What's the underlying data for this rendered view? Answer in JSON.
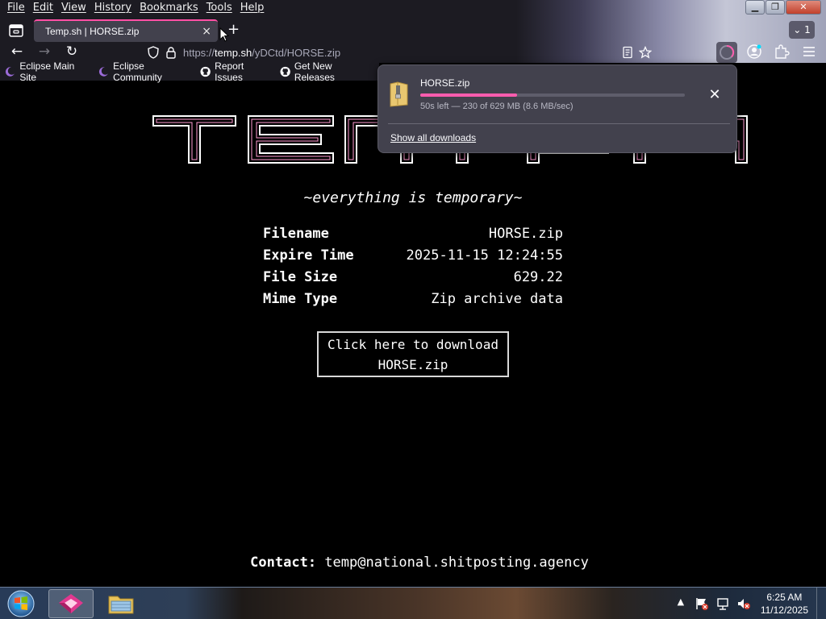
{
  "menubar": {
    "items": [
      "File",
      "Edit",
      "View",
      "History",
      "Bookmarks",
      "Tools",
      "Help"
    ]
  },
  "tab": {
    "title": "Temp.sh | HORSE.zip",
    "close": "×",
    "tab_count": "1"
  },
  "urlbar": {
    "prefix": "https://",
    "host": "temp.sh",
    "path": "/yDCtd/HORSE.zip"
  },
  "bookmarks": [
    {
      "label": "Eclipse Main Site",
      "icon": "eclipse-icon"
    },
    {
      "label": "Eclipse Community",
      "icon": "eclipse-icon"
    },
    {
      "label": "Report Issues",
      "icon": "github-icon"
    },
    {
      "label": "Get New Releases",
      "icon": "github-icon"
    }
  ],
  "page": {
    "logo": "TEMP.SH",
    "tagline": "~everything is temporary~",
    "info": [
      {
        "label": "Filename",
        "value": "HORSE.zip"
      },
      {
        "label": "Expire Time",
        "value": "2025-11-15 12:24:55"
      },
      {
        "label": "File Size",
        "value": "629.22"
      },
      {
        "label": "Mime Type",
        "value": "Zip archive data"
      }
    ],
    "download_button": {
      "line1": "Click here to download",
      "line2": "HORSE.zip"
    },
    "contact": {
      "label": "Contact:",
      "value": "temp@national.shitposting.agency"
    }
  },
  "download_panel": {
    "filename": "HORSE.zip",
    "status": "50s left — 230 of 629 MB (8.6 MB/sec)",
    "progress": 0.365,
    "show_all": "Show all downloads",
    "accent": "#ff5cae"
  },
  "taskbar": {
    "clock_time": "6:25 AM",
    "clock_date": "11/12/2025"
  }
}
